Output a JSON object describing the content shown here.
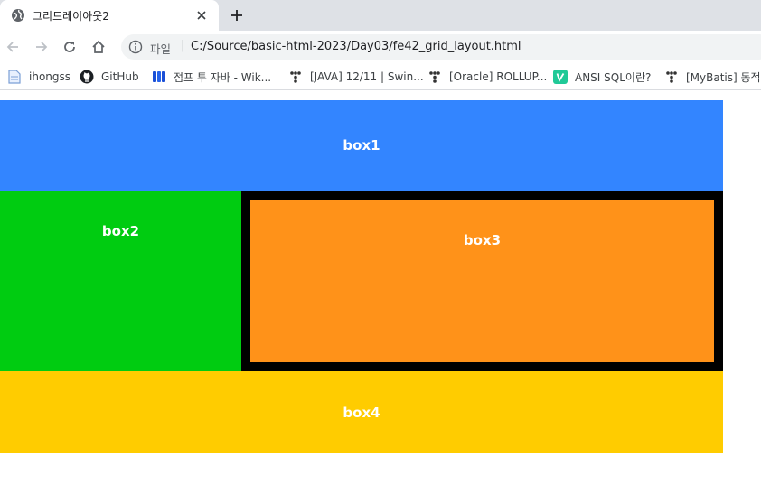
{
  "tab": {
    "title": "그리드레이아웃2",
    "favicon_icon": "globe-icon",
    "close_icon": "close-icon"
  },
  "new_tab_icon": "plus-icon",
  "toolbar": {
    "back_icon": "back-arrow-icon",
    "forward_icon": "forward-arrow-icon",
    "reload_icon": "reload-icon",
    "home_icon": "home-icon"
  },
  "omnibox": {
    "info_icon": "info-icon",
    "scheme_label": "파일",
    "separator": "|",
    "url": "C:/Source/basic-html-2023/Day03/fe42_grid_layout.html"
  },
  "bookmarks": [
    {
      "label": "ihongss",
      "icon": "page-icon"
    },
    {
      "label": "GitHub",
      "icon": "github-icon"
    },
    {
      "label": "점프 투 자바 - Wik...",
      "icon": "book-icon"
    },
    {
      "label": "[JAVA] 12/11 | Swin...",
      "icon": "tistory-icon"
    },
    {
      "label": "[Oracle] ROLLUP...",
      "icon": "tistory-icon"
    },
    {
      "label": "ANSI SQL이란?",
      "icon": "velog-icon"
    },
    {
      "label": "[MyBatis] 동적",
      "icon": "tistory-icon"
    }
  ],
  "grid": {
    "box1": "box1",
    "box2": "box2",
    "box3": "box3",
    "box4": "box4"
  },
  "colors": {
    "box1": "#3385ff",
    "box2": "#00cc11",
    "box3": "#ff9219",
    "box3_border": "#000000",
    "box4": "#ffcc00",
    "tabstrip": "#dee1e6"
  }
}
